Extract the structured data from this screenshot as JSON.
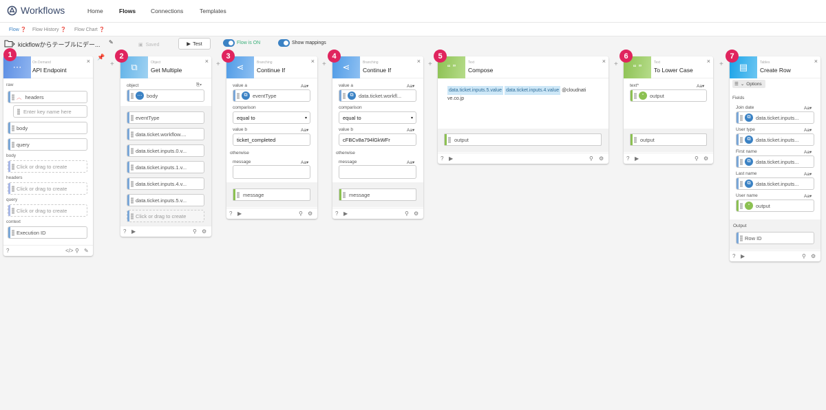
{
  "app": {
    "name": "Workflows"
  },
  "nav": {
    "home": "Home",
    "flows": "Flows",
    "connections": "Connections",
    "templates": "Templates"
  },
  "subnav": {
    "flow": "Flow",
    "flow_history": "Flow History",
    "flow_chart": "Flow Chart"
  },
  "toolbar": {
    "flow_name": "kickflowからテーブルにデー...",
    "saved": "Saved",
    "test": "Test",
    "flow_on": "Flow is ON",
    "show_mappings": "Show mappings"
  },
  "common": {
    "aa": "Aa",
    "output": "output",
    "message": "message",
    "comparison": "comparison",
    "equal_to": "equal to",
    "value_a": "value a",
    "value_b": "value b",
    "otherwise": "otherwise",
    "click_drag": "Click or drag to create"
  },
  "steps": [
    {
      "num": "1",
      "type": "On Demand",
      "title": "API Endpoint",
      "raw": "raw",
      "headers_field": "headers",
      "key_placeholder": "Enter key name here",
      "body_field": "body",
      "query_field": "query",
      "body_label": "body",
      "headers_label": "headers",
      "query_label": "query",
      "context_label": "context",
      "execution_id": "Execution ID"
    },
    {
      "num": "2",
      "type": "Object",
      "title": "Get Multiple",
      "object_label": "object",
      "object_value": "body",
      "outputs": [
        "eventType",
        "data.ticket.workflow....",
        "data.ticket.inputs.0.v...",
        "data.ticket.inputs.1.v...",
        "data.ticket.inputs.4.v...",
        "data.ticket.inputs.5.v..."
      ]
    },
    {
      "num": "3",
      "type": "Branching",
      "title": "Continue If",
      "value_a": "eventType",
      "value_b": "ticket_completed"
    },
    {
      "num": "4",
      "type": "Branching",
      "title": "Continue If",
      "value_a": "data.ticket.workfl...",
      "value_b": "cFBCv8a794lGkWFr"
    },
    {
      "num": "5",
      "type": "Text",
      "title": "Compose",
      "tag1": "data.ticket.inputs.5.value",
      "tag2": "data.ticket.inputs.4.value",
      "tail": "@cloudnati",
      "line2": "ve.co.jp"
    },
    {
      "num": "6",
      "type": "Text",
      "title": "To Lower Case",
      "text_label": "text*"
    },
    {
      "num": "7",
      "type": "Tables",
      "title": "Create Row",
      "options": "Options",
      "fields_label": "Fields",
      "fields": [
        {
          "label": "Join date",
          "value": "data.ticket.inputs..."
        },
        {
          "label": "User type",
          "value": "data.ticket.inputs..."
        },
        {
          "label": "First name",
          "value": "data.ticket.inputs..."
        },
        {
          "label": "Last name",
          "value": "data.ticket.inputs..."
        },
        {
          "label": "User name",
          "value": "output"
        }
      ],
      "output_label": "Output",
      "row_id": "Row ID"
    }
  ],
  "colors": {
    "accent": "#3b82c4",
    "badge": "#e0245e",
    "on_demand": "#5b8de3",
    "object": "#62b3e8",
    "branching": "#4f9be6",
    "text": "#8cc152",
    "tables": "#1aa3e8"
  }
}
